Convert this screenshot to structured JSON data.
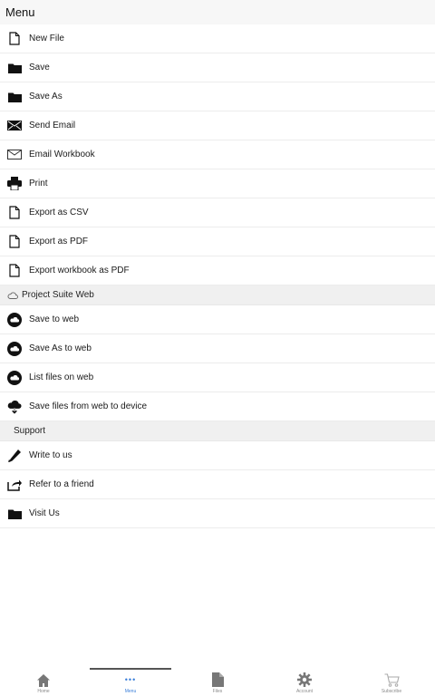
{
  "header": {
    "title": "Menu"
  },
  "menu": {
    "items": [
      {
        "label": "New File",
        "icon": "file-icon"
      },
      {
        "label": "Save",
        "icon": "folder-icon"
      },
      {
        "label": "Save As",
        "icon": "folder-icon"
      },
      {
        "label": "Send Email",
        "icon": "mail-filled-icon"
      },
      {
        "label": "Email Workbook",
        "icon": "mail-outline-icon"
      },
      {
        "label": "Print",
        "icon": "printer-icon"
      },
      {
        "label": "Export as CSV",
        "icon": "file-icon"
      },
      {
        "label": "Export as PDF",
        "icon": "file-icon"
      },
      {
        "label": "Export workbook as PDF",
        "icon": "file-icon"
      }
    ]
  },
  "web_section": {
    "title": "Project Suite Web",
    "items": [
      {
        "label": "Save to web",
        "icon": "cloud-circle-icon"
      },
      {
        "label": "Save As to web",
        "icon": "cloud-circle-icon"
      },
      {
        "label": "List files on web",
        "icon": "cloud-circle-icon"
      },
      {
        "label": "Save files from web to device",
        "icon": "cloud-download-icon"
      }
    ]
  },
  "support_section": {
    "title": "Support",
    "items": [
      {
        "label": "Write to us",
        "icon": "pencil-icon"
      },
      {
        "label": "Refer to a friend",
        "icon": "share-icon"
      },
      {
        "label": "Visit Us",
        "icon": "folder-icon"
      }
    ]
  },
  "tabs": [
    {
      "label": "Home",
      "icon": "home-icon"
    },
    {
      "label": "Menu",
      "icon": "more-dots-icon",
      "active": true
    },
    {
      "label": "Files",
      "icon": "file-icon"
    },
    {
      "label": "Account",
      "icon": "gear-icon"
    },
    {
      "label": "Subscribe",
      "icon": "cart-icon"
    }
  ]
}
